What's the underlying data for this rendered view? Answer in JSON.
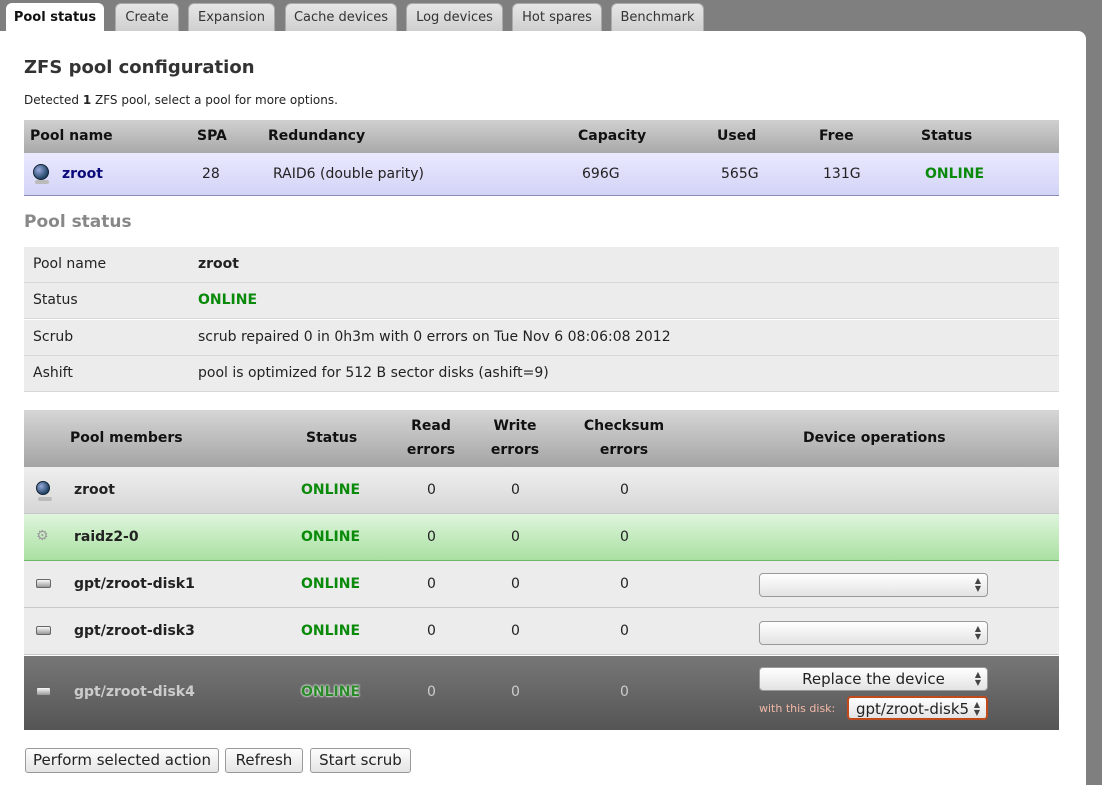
{
  "tabs": [
    "Pool status",
    "Create",
    "Expansion",
    "Cache devices",
    "Log devices",
    "Hot spares",
    "Benchmark"
  ],
  "title": "ZFS pool configuration",
  "detected": {
    "prefix": "Detected ",
    "count": "1",
    "suffix": " ZFS pool, select a pool for more options."
  },
  "pool_table": {
    "headers": [
      "Pool name",
      "SPA",
      "Redundancy",
      "Capacity",
      "Used",
      "Free",
      "Status"
    ],
    "row": {
      "name": "zroot",
      "spa": "28",
      "redundancy": "RAID6 (double parity)",
      "capacity": "696G",
      "used": "565G",
      "free": "131G",
      "status": "ONLINE"
    }
  },
  "pool_status": {
    "title": "Pool status",
    "rows": [
      {
        "key": "Pool name",
        "value": "zroot"
      },
      {
        "key": "Status",
        "value": "ONLINE"
      },
      {
        "key": "Scrub",
        "value": "scrub repaired 0 in 0h3m with 0 errors on Tue Nov 6 08:06:08 2012"
      },
      {
        "key": "Ashift",
        "value": "pool is optimized for 512 B sector disks (ashift=9)"
      }
    ]
  },
  "members": {
    "headers": {
      "name": "Pool members",
      "status": "Status",
      "read_1": "Read",
      "read_2": "errors",
      "write_1": "Write",
      "write_2": "errors",
      "checksum_1": "Checksum",
      "checksum_2": "errors",
      "ops": "Device operations"
    },
    "rows": [
      {
        "name": "zroot",
        "status": "ONLINE",
        "read": "0",
        "write": "0",
        "checksum": "0",
        "icon": "pool-globe-icon"
      },
      {
        "name": "raidz2-0",
        "status": "ONLINE",
        "read": "0",
        "write": "0",
        "checksum": "0",
        "icon": "gear-icon"
      },
      {
        "name": "gpt/zroot-disk1",
        "status": "ONLINE",
        "read": "0",
        "write": "0",
        "checksum": "0",
        "icon": "disk-icon",
        "operation": ""
      },
      {
        "name": "gpt/zroot-disk3",
        "status": "ONLINE",
        "read": "0",
        "write": "0",
        "checksum": "0",
        "icon": "disk-icon",
        "operation": ""
      },
      {
        "name": "gpt/zroot-disk4",
        "status": "ONLINE",
        "read": "0",
        "write": "0",
        "checksum": "0",
        "icon": "disk-icon",
        "operation": "Replace the device",
        "with_disk_label": "with this disk:",
        "with_disk_value": "gpt/zroot-disk5"
      }
    ]
  },
  "buttons": {
    "perform": "Perform selected action",
    "refresh": "Refresh",
    "scrub": "Start scrub"
  },
  "colors": {
    "online": "#0a8a0a",
    "selected_row": "#d3d3f6",
    "vdev_row": "#a9e0a2",
    "active_row": "#555555",
    "highlight_border": "#c04a1c"
  }
}
